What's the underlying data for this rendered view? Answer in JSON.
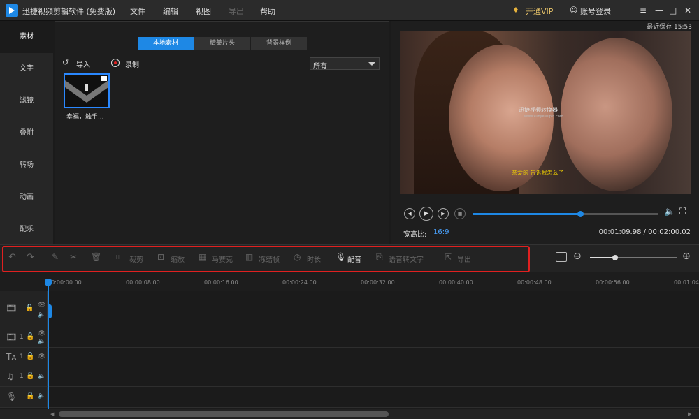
{
  "app": {
    "title": "迅捷视频剪辑软件 (免费版)"
  },
  "menu": {
    "file": "文件",
    "edit": "编辑",
    "view": "视图",
    "export": "导出",
    "help": "帮助"
  },
  "titlebar": {
    "vip": "开通VIP",
    "login": "账号登录",
    "menu_icon": "≡",
    "min_icon": "—",
    "max_icon": "□",
    "close_icon": "✕"
  },
  "sidebar": {
    "items": [
      {
        "label": "素材"
      },
      {
        "label": "文字"
      },
      {
        "label": "滤镜"
      },
      {
        "label": "叠附"
      },
      {
        "label": "转场"
      },
      {
        "label": "动画"
      },
      {
        "label": "配乐"
      }
    ]
  },
  "media": {
    "tabs": [
      {
        "label": "本地素材"
      },
      {
        "label": "精美片头"
      },
      {
        "label": "背景样例"
      }
    ],
    "import_label": "导入",
    "record_label": "录制",
    "filter_value": "所有",
    "clip_name": "幸福，触手..."
  },
  "preview": {
    "last_saved": "最近保存 15:53",
    "watermark": "迅捷视频转换器",
    "watermark_url": "www.xunjieshipin.com",
    "subtitle": "亲爱的  告诉我怎么了",
    "aspect_label": "宽高比:",
    "aspect_value": "16:9",
    "time": "00:01:09.98 / 00:02:00.02",
    "progress": 0.58
  },
  "toolbar": {
    "crop": "裁剪",
    "zoom": "缩放",
    "mosaic": "马赛克",
    "freeze": "冻结帧",
    "duration": "时长",
    "dub": "配音",
    "speech_to_text": "语音转文字",
    "export": "导出"
  },
  "ruler": {
    "ticks": [
      "00:00:00.00",
      "00:00:08.00",
      "00:00:16.00",
      "00:00:24.00",
      "00:00:32.00",
      "00:00:40.00",
      "00:00:48.00",
      "00:00:56.00",
      "00:01:04"
    ]
  },
  "tracks": {
    "track_num": "1"
  },
  "colors": {
    "accent": "#1e88e5",
    "highlight": "#e02020"
  }
}
